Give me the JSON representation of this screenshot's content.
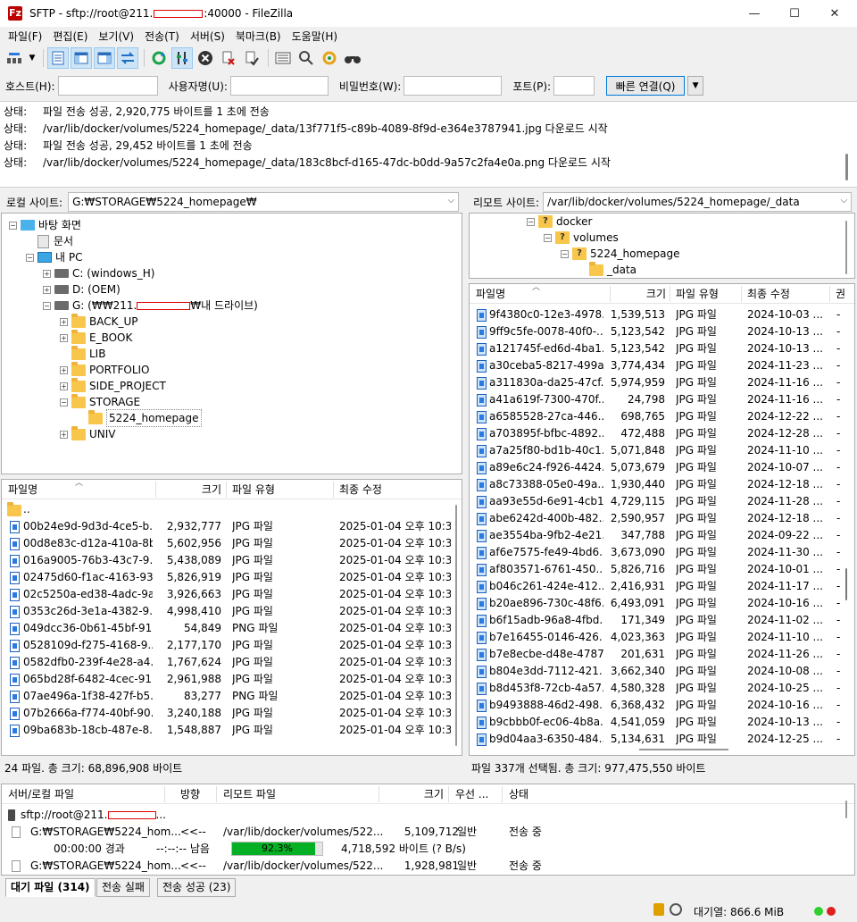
{
  "window": {
    "title_prefix": "SFTP - sftp://root@211.",
    "title_suffix": ":40000 - FileZilla",
    "minimize": "—",
    "maximize": "☐",
    "close": "✕"
  },
  "menu": [
    "파일(F)",
    "편집(E)",
    "보기(V)",
    "전송(T)",
    "서버(S)",
    "북마크(B)",
    "도움말(H)"
  ],
  "toolbar": {
    "icons": [
      "site-manager-icon",
      "dropdown-icon",
      "toggle-log-icon",
      "toggle-local-tree-icon",
      "toggle-remote-tree-icon",
      "toggle-queue-icon",
      "refresh-icon",
      "process-queue-icon",
      "cancel-icon",
      "disconnect-icon",
      "reconnect-icon",
      "filter-icon",
      "compare-icon",
      "sync-browse-icon",
      "search-icon"
    ]
  },
  "quickconnect": {
    "host_label": "호스트(H):",
    "user_label": "사용자명(U):",
    "password_label": "비밀번호(W):",
    "port_label": "포트(P):",
    "host_value": "",
    "user_value": "",
    "password_value": "",
    "port_value": "",
    "button": "빠른 연결(Q)",
    "dropdown": "▼"
  },
  "log": [
    {
      "label": "상태:",
      "text": "파일 전송 성공, 2,920,775 바이트를 1 초에 전송"
    },
    {
      "label": "상태:",
      "text": "/var/lib/docker/volumes/5224_homepage/_data/13f771f5-c89b-4089-8f9d-e364e3787941.jpg 다운로드 시작"
    },
    {
      "label": "상태:",
      "text": "파일 전송 성공, 29,452 바이트를 1 초에 전송"
    },
    {
      "label": "상태:",
      "text": "/var/lib/docker/volumes/5224_homepage/_data/183c8bcf-d165-47dc-b0dd-9a57c2fa4e0a.png 다운로드 시작"
    }
  ],
  "local": {
    "site_label": "로컬 사이트:",
    "site_path": "G:₩STORAGE₩5224_homepage₩",
    "tree": [
      {
        "level": 0,
        "exp": "⊟",
        "icon": "desktop",
        "label": "바탕 화면"
      },
      {
        "level": 1,
        "exp": "",
        "icon": "doc",
        "label": "문서"
      },
      {
        "level": 1,
        "exp": "⊟",
        "icon": "pc",
        "label": "내 PC"
      },
      {
        "level": 2,
        "exp": "⊞",
        "icon": "drive",
        "label": "C: (windows_H)"
      },
      {
        "level": 2,
        "exp": "⊞",
        "icon": "drive",
        "label": "D: (OEM)"
      },
      {
        "level": 2,
        "exp": "⊟",
        "icon": "drive",
        "label": "G: (₩₩211.",
        "redact": true,
        "suffix": "₩내 드라이브)"
      },
      {
        "level": 3,
        "exp": "⊞",
        "icon": "folder",
        "label": "BACK_UP"
      },
      {
        "level": 3,
        "exp": "⊞",
        "icon": "folder",
        "label": "E_BOOK"
      },
      {
        "level": 3,
        "exp": "",
        "icon": "folder",
        "label": "LIB"
      },
      {
        "level": 3,
        "exp": "⊞",
        "icon": "folder",
        "label": "PORTFOLIO"
      },
      {
        "level": 3,
        "exp": "⊞",
        "icon": "folder",
        "label": "SIDE_PROJECT"
      },
      {
        "level": 3,
        "exp": "⊟",
        "icon": "folder",
        "label": "STORAGE"
      },
      {
        "level": 4,
        "exp": "",
        "icon": "folder",
        "label": "5224_homepage",
        "selected": true
      },
      {
        "level": 3,
        "exp": "⊞",
        "icon": "folder",
        "label": "UNIV"
      }
    ],
    "columns": [
      "파일명",
      "크기",
      "파일 유형",
      "최종 수정"
    ],
    "parent_row": "..",
    "files": [
      [
        "00b24e9d-9d3d-4ce5-b...",
        "2,932,777",
        "JPG 파일",
        "2025-01-04 오후 10:3"
      ],
      [
        "00d8e83c-d12a-410a-8b...",
        "5,602,956",
        "JPG 파일",
        "2025-01-04 오후 10:3"
      ],
      [
        "016a9005-76b3-43c7-9...",
        "5,438,089",
        "JPG 파일",
        "2025-01-04 오후 10:3"
      ],
      [
        "02475d60-f1ac-4163-93...",
        "5,826,919",
        "JPG 파일",
        "2025-01-04 오후 10:3"
      ],
      [
        "02c5250a-ed38-4adc-9a...",
        "3,926,663",
        "JPG 파일",
        "2025-01-04 오후 10:3"
      ],
      [
        "0353c26d-3e1a-4382-9...",
        "4,998,410",
        "JPG 파일",
        "2025-01-04 오후 10:3"
      ],
      [
        "049dcc36-0b61-45bf-91...",
        "54,849",
        "PNG 파일",
        "2025-01-04 오후 10:3"
      ],
      [
        "0528109d-f275-4168-9...",
        "2,177,170",
        "JPG 파일",
        "2025-01-04 오후 10:3"
      ],
      [
        "0582dfb0-239f-4e28-a4...",
        "1,767,624",
        "JPG 파일",
        "2025-01-04 오후 10:3"
      ],
      [
        "065bd28f-6482-4cec-91...",
        "2,961,988",
        "JPG 파일",
        "2025-01-04 오후 10:3"
      ],
      [
        "07ae496a-1f38-427f-b5...",
        "83,277",
        "PNG 파일",
        "2025-01-04 오후 10:3"
      ],
      [
        "07b2666a-f774-40bf-90...",
        "3,240,188",
        "JPG 파일",
        "2025-01-04 오후 10:3"
      ],
      [
        "09ba683b-18cb-487e-8...",
        "1,548,887",
        "JPG 파일",
        "2025-01-04 오후 10:3"
      ]
    ],
    "status": "24 파일. 총 크기: 68,896,908 바이트"
  },
  "remote": {
    "site_label": "리모트 사이트:",
    "site_path": "/var/lib/docker/volumes/5224_homepage/_data",
    "tree": [
      {
        "level": 0,
        "exp": "⊟",
        "label": "docker"
      },
      {
        "level": 1,
        "exp": "⊟",
        "label": "volumes"
      },
      {
        "level": 2,
        "exp": "⊟",
        "label": "5224_homepage"
      },
      {
        "level": 3,
        "exp": "",
        "label": "_data",
        "plain": true
      }
    ],
    "columns": [
      "파일명",
      "크기",
      "파일 유형",
      "최종 수정",
      "권"
    ],
    "files": [
      [
        "9f4380c0-12e3-4978...",
        "1,539,513",
        "JPG 파일",
        "2024-10-03 ...",
        "-"
      ],
      [
        "9ff9c5fe-0078-40f0-...",
        "5,123,542",
        "JPG 파일",
        "2024-10-13 ...",
        "-"
      ],
      [
        "a121745f-ed6d-4ba1...",
        "5,123,542",
        "JPG 파일",
        "2024-10-13 ...",
        "-"
      ],
      [
        "a30ceba5-8217-499a...",
        "3,774,434",
        "JPG 파일",
        "2024-11-23 ...",
        "-"
      ],
      [
        "a311830a-da25-47cf...",
        "5,974,959",
        "JPG 파일",
        "2024-11-16 ...",
        "-"
      ],
      [
        "a41a619f-7300-470f...",
        "24,798",
        "JPG 파일",
        "2024-11-16 ...",
        "-"
      ],
      [
        "a6585528-27ca-446...",
        "698,765",
        "JPG 파일",
        "2024-12-22 ...",
        "-"
      ],
      [
        "a703895f-bfbc-4892...",
        "472,488",
        "JPG 파일",
        "2024-12-28 ...",
        "-"
      ],
      [
        "a7a25f80-bd1b-40c1...",
        "5,071,848",
        "JPG 파일",
        "2024-11-10 ...",
        "-"
      ],
      [
        "a89e6c24-f926-4424...",
        "5,073,679",
        "JPG 파일",
        "2024-10-07 ...",
        "-"
      ],
      [
        "a8c73388-05e0-49a...",
        "1,930,440",
        "JPG 파일",
        "2024-12-18 ...",
        "-"
      ],
      [
        "aa93e55d-6e91-4cb1...",
        "4,729,115",
        "JPG 파일",
        "2024-11-28 ...",
        "-"
      ],
      [
        "abe6242d-400b-482...",
        "2,590,957",
        "JPG 파일",
        "2024-12-18 ...",
        "-"
      ],
      [
        "ae3554ba-9fb2-4e21...",
        "347,788",
        "JPG 파일",
        "2024-09-22 ...",
        "-"
      ],
      [
        "af6e7575-fe49-4bd6...",
        "3,673,090",
        "JPG 파일",
        "2024-11-30 ...",
        "-"
      ],
      [
        "af803571-6761-450...",
        "5,826,716",
        "JPG 파일",
        "2024-10-01 ...",
        "-"
      ],
      [
        "b046c261-424e-412...",
        "2,416,931",
        "JPG 파일",
        "2024-11-17 ...",
        "-"
      ],
      [
        "b20ae896-730c-48f6...",
        "6,493,091",
        "JPG 파일",
        "2024-10-16 ...",
        "-"
      ],
      [
        "b6f15adb-96a8-4fbd...",
        "171,349",
        "JPG 파일",
        "2024-11-02 ...",
        "-"
      ],
      [
        "b7e16455-0146-426...",
        "4,023,363",
        "JPG 파일",
        "2024-11-10 ...",
        "-"
      ],
      [
        "b7e8ecbe-d48e-4787...",
        "201,631",
        "JPG 파일",
        "2024-11-26 ...",
        "-"
      ],
      [
        "b804e3dd-7112-421...",
        "3,662,340",
        "JPG 파일",
        "2024-10-08 ...",
        "-"
      ],
      [
        "b8d453f8-72cb-4a57...",
        "4,580,328",
        "JPG 파일",
        "2024-10-25 ...",
        "-"
      ],
      [
        "b9493888-46d2-498...",
        "6,368,432",
        "JPG 파일",
        "2024-10-16 ...",
        "-"
      ],
      [
        "b9cbbb0f-ec06-4b8a...",
        "4,541,059",
        "JPG 파일",
        "2024-10-13 ...",
        "-"
      ],
      [
        "b9d04aa3-6350-484...",
        "5,134,631",
        "JPG 파일",
        "2024-12-25 ...",
        "-"
      ]
    ],
    "status": "파일 337개 선택됨. 총 크기: 977,475,550 바이트"
  },
  "queue": {
    "columns": [
      "서버/로컬 파일",
      "방향",
      "리모트 파일",
      "크기",
      "우선 ...",
      "상태"
    ],
    "server": "sftp://root@211.",
    "rows": [
      {
        "local": "G:₩STORAGE₩5224_hom...",
        "dir": "<<--",
        "remote": "/var/lib/docker/volumes/522...",
        "size": "5,109,712",
        "priority": "일반",
        "status": "전송 중"
      },
      {
        "local": "G:₩STORAGE₩5224_hom...",
        "dir": "<<--",
        "remote": "/var/lib/docker/volumes/522...",
        "size": "1,928,981",
        "priority": "일반",
        "status": "전송 중"
      }
    ],
    "elapsed": "00:00:00 경과",
    "remaining": "--:--:-- 남음",
    "progress_percent": 92.3,
    "progress_text": "92.3%",
    "transferred": "4,718,592 바이트 (? B/s)"
  },
  "tabs": [
    "대기 파일 (314)",
    "전송 실패",
    "전송 성공 (23)"
  ],
  "bottom": {
    "queue_label": "대기열: 866.6 MiB"
  },
  "colors": {
    "progress": "#06b025",
    "led_green": "#2fcf2f",
    "led_red": "#e02020"
  }
}
